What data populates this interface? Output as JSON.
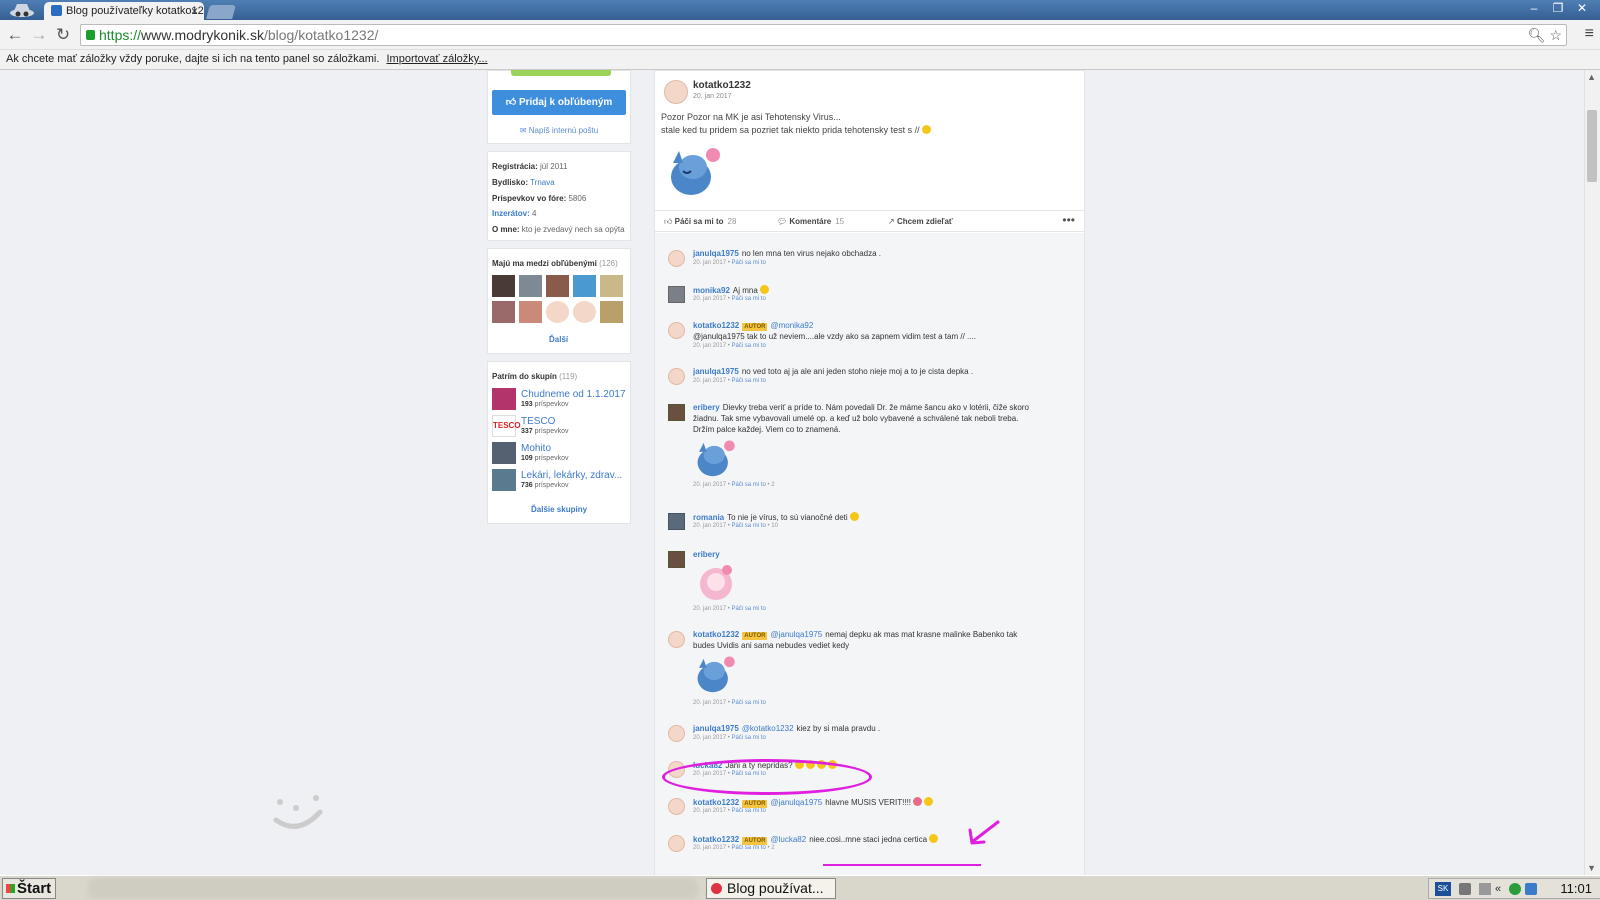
{
  "browser": {
    "tab_title": "Blog používateľky kotatko1232",
    "url_https": "https://",
    "url_host": "www.modrykonik.sk",
    "url_path": "/blog/kotatko1232/",
    "bookmark_bar_text": "Ak chcete mať záložky vždy poruke, dajte si ich na tento panel so záložkami.",
    "bookmark_bar_link": "Importovať záložky..."
  },
  "sidebar": {
    "favorite_button": "Pridaj k obľúbeným",
    "mail_link": "Napíš internú poštu",
    "profile": {
      "registration_label": "Registrácia:",
      "registration_value": "júl 2011",
      "residence_label": "Bydlisko:",
      "residence_value": "Trnava",
      "posts_label": "Príspevkov vo fóre:",
      "posts_value": "5806",
      "ads_label": "Inzerátov:",
      "ads_value": "4",
      "about_label": "O mne:",
      "about_value": "kto je zvedavý nech sa opýta"
    },
    "favorites": {
      "title": "Majú ma medzi obľúbenými",
      "count": "(126)",
      "more": "Ďalší"
    },
    "groups": {
      "title": "Patrím do skupín",
      "count": "(119)",
      "items": [
        {
          "name": "Chudneme od 1.1.2017",
          "posts": "193",
          "posts_label": "príspevkov"
        },
        {
          "name": "TESCO",
          "posts": "337",
          "posts_label": "príspevkov"
        },
        {
          "name": "Mohito",
          "posts": "109",
          "posts_label": "príspevkov"
        },
        {
          "name": "Lekári, lekárky, zdrav...",
          "posts": "736",
          "posts_label": "príspevkov"
        }
      ],
      "more": "Ďalšie skupiny"
    }
  },
  "post": {
    "author": "kotatko1232",
    "date": "20. jan 2017",
    "line1": "Pozor Pozor na MK je asi Tehotensky Virus...",
    "line2": "stale ked tu pridem sa pozriet tak niekto prida tehotensky test s //",
    "like_label": "Páči sa mi to",
    "like_count": "28",
    "comments_label": "Komentáre",
    "comments_count": "15",
    "share_label": "Chcem zdieľať",
    "more": "•••"
  },
  "comments": [
    {
      "user": "janulqa1975",
      "text": "no len mna ten virus nejako obchadza .",
      "date": "20. jan 2017",
      "like": "Páči sa mi to"
    },
    {
      "user": "monika92",
      "text": "Aj mna",
      "date": "20. jan 2017",
      "like": "Páči sa mi to"
    },
    {
      "user": "kotatko1232",
      "badge": "AUTOR",
      "mention": "@monika92",
      "text": "",
      "text2": "@janulqa1975 tak to už neviem....ale vzdy ako sa zapnem vidim test a tam // ....",
      "date": "20. jan 2017",
      "like": "Páči sa mi to"
    },
    {
      "user": "janulqa1975",
      "text": "no ved toto aj ja ale ani jeden stoho nieje moj a to je cista depka .",
      "date": "20. jan 2017",
      "like": "Páči sa mi to"
    },
    {
      "user": "eribery",
      "text": "Dievky treba veriť a príde to. Nám povedali Dr. že máme šancu ako v lotérii, čiže skoro",
      "text2": "žiadnu. Tak sme vybavovali umelé op. a keď už bolo vybavené a schválené tak neboli treba.",
      "text3": "Držím palce každej. Viem co to znamená.",
      "date": "20. jan 2017",
      "like": "Páči sa mi to",
      "count": "2"
    },
    {
      "user": "romania",
      "text": "To nie je vírus, to sú vianočné deti",
      "date": "20. jan 2017",
      "like": "Páči sa mi to",
      "count": "10"
    },
    {
      "user": "eribery",
      "text": "",
      "date": "20. jan 2017",
      "like": "Páči sa mi to"
    },
    {
      "user": "kotatko1232",
      "badge": "AUTOR",
      "mention": "@janulqa1975",
      "text": "nemaj depku ak mas mat krasne malinke Babenko tak",
      "text2": "budes Uvidis ani sama nebudes vediet kedy",
      "date": "20. jan 2017",
      "like": "Páči sa mi to"
    },
    {
      "user": "janulqa1975",
      "mention": "@kotatko1232",
      "text": "kiez by si mala pravdu .",
      "date": "20. jan 2017",
      "like": "Páči sa mi to"
    },
    {
      "user": "lucka82",
      "text": "Jani a ty nepridas?",
      "date": "20. jan 2017",
      "like": "Páči sa mi to"
    },
    {
      "user": "kotatko1232",
      "badge": "AUTOR",
      "mention": "@janulqa1975",
      "text": "hlavne MUSIS VERIT!!!!",
      "date": "20. jan 2017",
      "like": "Páči sa mi to"
    },
    {
      "user": "kotatko1232",
      "badge": "AUTOR",
      "mention": "@lucka82",
      "text": "niee.cosi..mne staci jedna certica",
      "date": "20. jan 2017",
      "like": "Páči sa mi to",
      "count": "2"
    }
  ],
  "taskbar": {
    "start": "Štart",
    "task": "Blog používat...",
    "lang": "SK",
    "clock": "11:01"
  },
  "colors": {
    "link_blue": "#3d7bc8",
    "button_blue": "#3e8ede",
    "annotation_magenta": "#e020e0",
    "author_badge": "#f5c542"
  }
}
